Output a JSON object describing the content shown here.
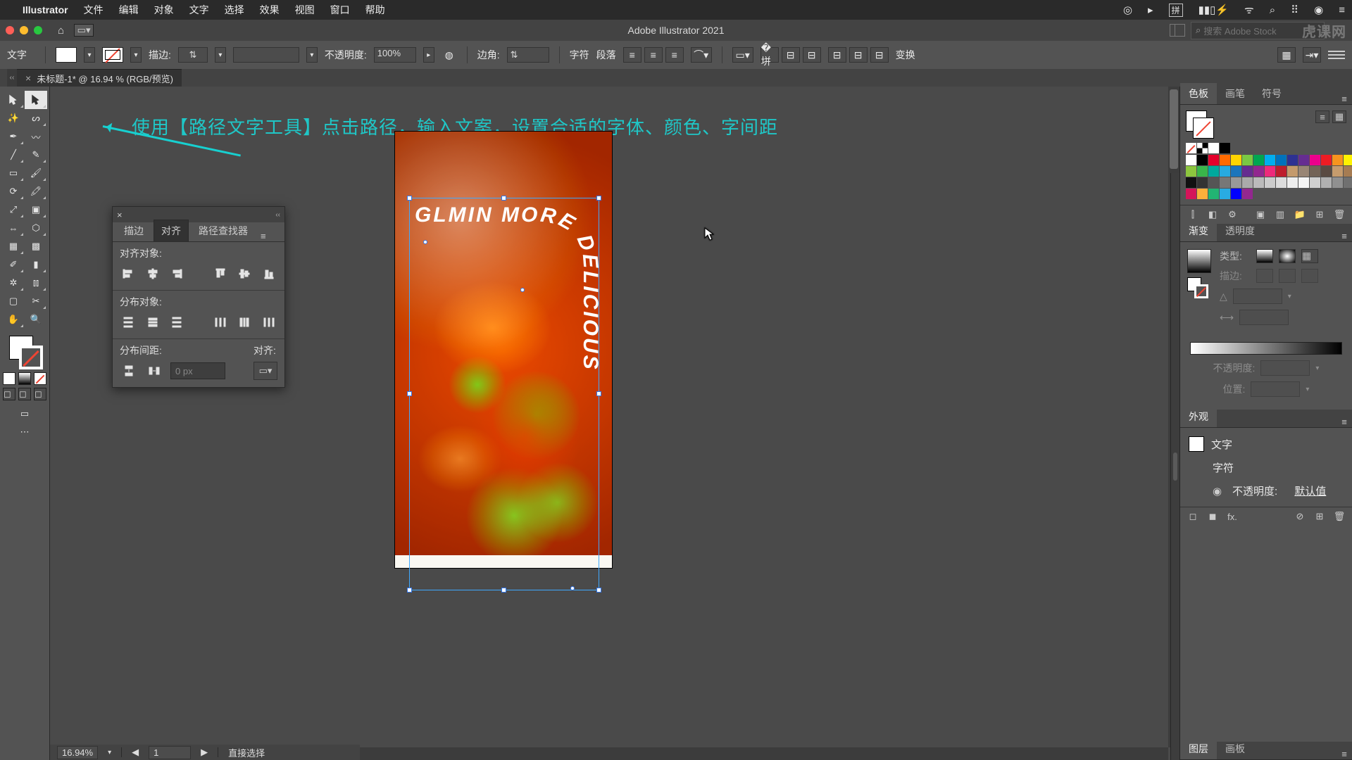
{
  "menubar": {
    "app": "Illustrator",
    "items": [
      "文件",
      "编辑",
      "对象",
      "文字",
      "选择",
      "效果",
      "视图",
      "窗口",
      "帮助"
    ],
    "right_icons": [
      "record",
      "play",
      "ime",
      "battery",
      "wifi",
      "search",
      "control",
      "siri",
      "notifications"
    ],
    "ime_label": "拼"
  },
  "chrome": {
    "title": "Adobe Illustrator 2021",
    "search_placeholder": "搜索 Adobe Stock",
    "watermark": "虎课网"
  },
  "control": {
    "mode": "文字",
    "stroke_label": "描边:",
    "stroke_value": "",
    "opacity_label": "不透明度:",
    "opacity_value": "100%",
    "corner_label": "边角:",
    "corner_value": "",
    "char_label": "字符",
    "para_label": "段落",
    "transform_label": "变换"
  },
  "doc_tab": {
    "name": "未标题-1* @ 16.94 % (RGB/预览)"
  },
  "status": {
    "zoom": "16.94%",
    "artboard_nav": "1",
    "tool_hint": "直接选择"
  },
  "annotation": {
    "text": "使用【路径文字工具】点击路径，输入文案，设置合适的字体、颜色、字间距"
  },
  "artwork": {
    "path_text": "GLMIN  MORE  DELICIOUS"
  },
  "align_panel": {
    "tabs": [
      "描边",
      "对齐",
      "路径查找器"
    ],
    "active_tab": 1,
    "section_align": "对齐对象:",
    "section_distribute": "分布对象:",
    "section_spacing": "分布间距:",
    "align_to_label": "对齐:",
    "spacing_value": "0 px"
  },
  "swatches": {
    "tabs": [
      "色板",
      "画笔",
      "符号"
    ],
    "colors_row1": [
      "#ffffff",
      "#000000",
      "#e4002b",
      "#ff6a00",
      "#ffd400",
      "#7ac943",
      "#00a651",
      "#00aeef",
      "#0072bc",
      "#2e3192",
      "#662d91",
      "#ec008c",
      "#ed1c24",
      "#f7941d",
      "#fff200"
    ],
    "colors_row2": [
      "#8dc63e",
      "#39b54a",
      "#00a99d",
      "#27aae1",
      "#1b75bc",
      "#652d90",
      "#92278f",
      "#ee2a7b",
      "#be1e2d",
      "#c49a6c",
      "#998675",
      "#736357",
      "#594a42",
      "#c69c6d",
      "#a67c52"
    ],
    "colors_row3": [
      "#111111",
      "#333333",
      "#555555",
      "#777777",
      "#999999",
      "#aaaaaa",
      "#bbbbbb",
      "#cccccc",
      "#dddddd",
      "#eeeeee",
      "#f5f5f5",
      "#d0d0d0",
      "#b0b0b0",
      "#909090",
      "#707070"
    ],
    "colors_row4": [
      "#d4145a",
      "#fbb03b",
      "#22b573",
      "#29abe2",
      "#0000ff",
      "#93278f"
    ]
  },
  "gradient_panel": {
    "tabs": [
      "渐变",
      "透明度"
    ],
    "type_label": "类型:",
    "stroke_label": "描边:",
    "opacity_label": "不透明度:",
    "position_label": "位置:"
  },
  "appearance_panel": {
    "tab": "外观",
    "object_type": "文字",
    "char_label": "字符",
    "opacity_label": "不透明度:",
    "opacity_value": "默认值"
  },
  "layers_panel": {
    "tabs": [
      "图层",
      "画板"
    ]
  }
}
